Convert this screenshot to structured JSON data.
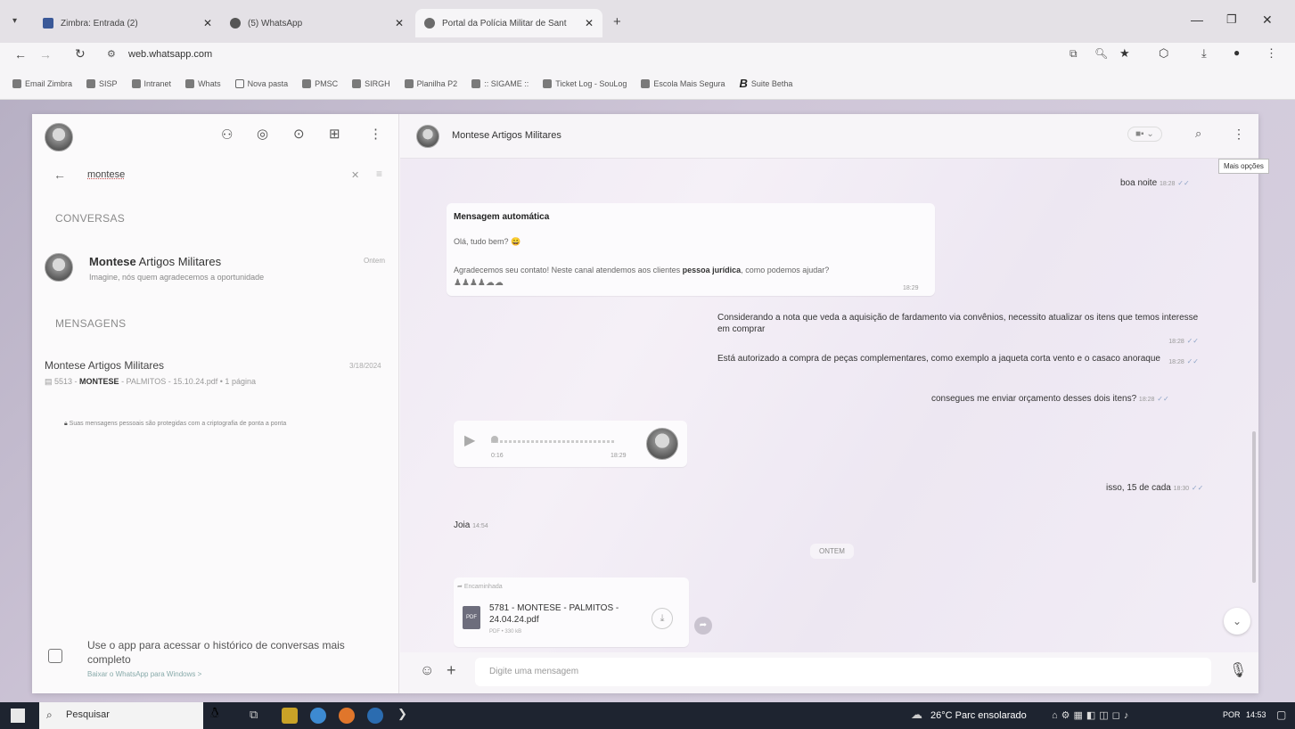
{
  "browser": {
    "tabs": [
      {
        "label": "Zimbra: Entrada (2)"
      },
      {
        "label": "(5) WhatsApp"
      },
      {
        "label": "Portal da Polícia Militar de Sant"
      }
    ],
    "url": "web.whatsapp.com",
    "bookmarks": [
      "Email Zimbra",
      "SISP",
      "Intranet",
      "Whats",
      "Nova pasta",
      "PMSC",
      "SIRGH",
      "Planilha P2",
      ":: SIGAME ::",
      "Ticket Log - SouLog",
      "Escola Mais Segura",
      "Suite Betha"
    ]
  },
  "sidebar": {
    "search_value": "montese",
    "conversations_header": "CONVERSAS",
    "conversation": {
      "name_bold": "Montese",
      "name_rest": " Artigos Militares",
      "preview": "Imagine, nós quem agradecemos a oportunidade",
      "time": "Ontem"
    },
    "messages_header": "MENSAGENS",
    "message_result": {
      "name": "Montese Artigos Militares",
      "date": "3/18/2024",
      "prefix": "5513 - ",
      "bold": "MONTESE",
      "rest": " - PALMITOS - 15.10.24.pdf • 1 página"
    },
    "encryption_note": "Suas mensagens pessoais são protegidas com a criptografia de ponta a ponta",
    "promo": {
      "text": "Use o app para acessar o histórico de conversas mais completo",
      "link": "Baixar o WhatsApp para Windows >"
    }
  },
  "chat": {
    "contact_name": "Montese Artigos Militares",
    "tooltip": "Mais opções",
    "messages": {
      "m1": {
        "text": "boa noite",
        "time": "18:28"
      },
      "auto_title": "Mensagem automática",
      "auto_greeting": "Olá, tudo bem? 😀",
      "auto_body_a": "Agradecemos seu contato! Neste canal atendemos aos clientes ",
      "auto_body_bold": "pessoa jurídica",
      "auto_body_b": ", como podemos ajudar?",
      "auto_time": "18:29",
      "m2": {
        "text": "Considerando a nota que veda a aquisição de fardamento via convênios, necessito atualizar os itens que temos interesse em comprar",
        "time": "18:28"
      },
      "m3": {
        "text": "Está autorizado a compra de peças complementares, como exemplo a jaqueta corta vento e o casaco anoraque",
        "time": "18:28"
      },
      "m4": {
        "text": "consegues me enviar orçamento desses dois itens?",
        "time": "18:28"
      },
      "voice": {
        "duration": "0:16",
        "time": "18:29"
      },
      "m5": {
        "text": "isso, 15 de cada",
        "time": "18:30"
      },
      "m6": {
        "text": "Joia",
        "time": "14:54"
      },
      "date_divider": "ONTEM",
      "forwarded_label": "Encaminhada",
      "file": {
        "name": "5781 - MONTESE - PALMITOS - 24.04.24.pdf",
        "meta": "PDF • 330 kB"
      }
    },
    "input_placeholder": "Digite uma mensagem"
  },
  "taskbar": {
    "search_placeholder": "Pesquisar",
    "weather": "26°C  Parc ensolarado",
    "language": "POR",
    "clock": "14:53"
  }
}
